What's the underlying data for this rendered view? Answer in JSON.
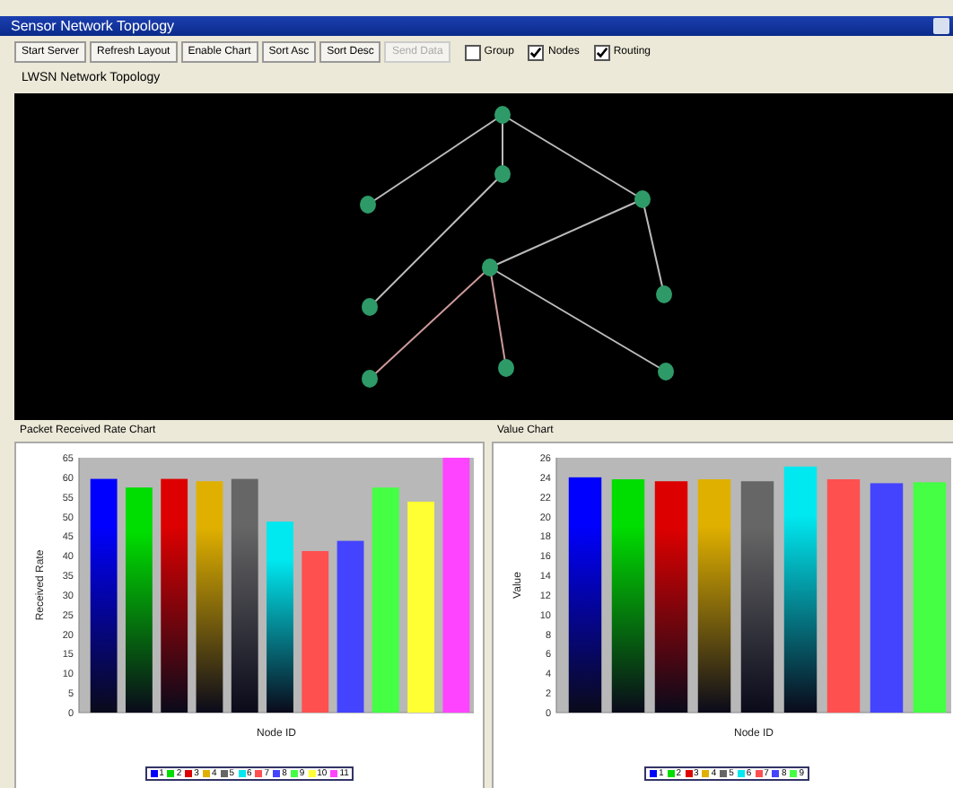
{
  "window": {
    "title": "Sensor Network Topology"
  },
  "toolbar": {
    "buttons": [
      {
        "label": "Start Server",
        "disabled": false
      },
      {
        "label": "Refresh Layout",
        "disabled": false
      },
      {
        "label": "Enable Chart",
        "disabled": false
      },
      {
        "label": "Sort Asc",
        "disabled": false
      },
      {
        "label": "Sort Desc",
        "disabled": false
      },
      {
        "label": "Send Data",
        "disabled": true
      }
    ],
    "checkboxes": [
      {
        "label": "Group",
        "checked": false
      },
      {
        "label": "Nodes",
        "checked": true
      },
      {
        "label": "Routing",
        "checked": true
      }
    ]
  },
  "topology": {
    "title": "LWSN Network Topology"
  },
  "charts": [
    {
      "title": "Packet Received Rate Chart",
      "chart_data": {
        "type": "bar",
        "xlabel": "Node ID",
        "ylabel": "Received Rate",
        "categories": [
          null,
          null,
          null,
          null,
          null,
          null,
          null,
          null,
          null,
          null,
          null
        ],
        "ylim": [
          0,
          65
        ],
        "yticks": [
          0,
          5,
          10,
          15,
          20,
          25,
          30,
          35,
          40,
          45,
          50,
          55,
          60,
          65
        ],
        "values": [
          59.6,
          57.4,
          59.6,
          59,
          59.6,
          48.7,
          41.2,
          43.8,
          57.4,
          53.8,
          65
        ]
      },
      "bar_styles": [
        {
          "color": "#0000ff",
          "gradient": true
        },
        {
          "color": "#00dd00",
          "gradient": true
        },
        {
          "color": "#dd0000",
          "gradient": true
        },
        {
          "color": "#e0b000",
          "gradient": true
        },
        {
          "color": "#666666",
          "gradient": true
        },
        {
          "color": "#00e8f0",
          "gradient": true
        },
        {
          "color": "#ff5050",
          "gradient": false
        },
        {
          "color": "#4444ff",
          "gradient": false
        },
        {
          "color": "#44ff44",
          "gradient": false
        },
        {
          "color": "#ffff33",
          "gradient": false
        },
        {
          "color": "#ff44ff",
          "gradient": false
        }
      ],
      "legend": [
        {
          "label": "1",
          "color": "#0000ff"
        },
        {
          "label": "2",
          "color": "#00dd00"
        },
        {
          "label": "3",
          "color": "#dd0000"
        },
        {
          "label": "4",
          "color": "#e0b000"
        },
        {
          "label": "5",
          "color": "#666666"
        },
        {
          "label": "6",
          "color": "#00e8f0"
        },
        {
          "label": "7",
          "color": "#ff5050"
        },
        {
          "label": "8",
          "color": "#4444ff"
        },
        {
          "label": "9",
          "color": "#44ff44"
        },
        {
          "label": "10",
          "color": "#ffff33"
        },
        {
          "label": "11",
          "color": "#ff44ff"
        }
      ]
    },
    {
      "title": "Value Chart",
      "chart_data": {
        "type": "bar",
        "xlabel": "Node ID",
        "ylabel": "Value",
        "categories": [
          null,
          null,
          null,
          null,
          null,
          null,
          null,
          null,
          null
        ],
        "ylim": [
          0,
          26
        ],
        "yticks": [
          0,
          2,
          4,
          6,
          8,
          10,
          12,
          14,
          16,
          18,
          20,
          22,
          24,
          26
        ],
        "values": [
          24,
          23.8,
          23.6,
          23.8,
          23.6,
          25.1,
          23.8,
          23.4,
          23.5
        ]
      },
      "bar_styles": [
        {
          "color": "#0000ff",
          "gradient": true
        },
        {
          "color": "#00dd00",
          "gradient": true
        },
        {
          "color": "#dd0000",
          "gradient": true
        },
        {
          "color": "#e0b000",
          "gradient": true
        },
        {
          "color": "#666666",
          "gradient": true
        },
        {
          "color": "#00e8f0",
          "gradient": true
        },
        {
          "color": "#ff5050",
          "gradient": false
        },
        {
          "color": "#4444ff",
          "gradient": false
        },
        {
          "color": "#44ff44",
          "gradient": false
        }
      ],
      "legend": [
        {
          "label": "1",
          "color": "#0000ff"
        },
        {
          "label": "2",
          "color": "#00dd00"
        },
        {
          "label": "3",
          "color": "#dd0000"
        },
        {
          "label": "4",
          "color": "#e0b000"
        },
        {
          "label": "5",
          "color": "#666666"
        },
        {
          "label": "6",
          "color": "#00e8f0"
        },
        {
          "label": "7",
          "color": "#ff5050"
        },
        {
          "label": "8",
          "color": "#4444ff"
        },
        {
          "label": "9",
          "color": "#44ff44"
        }
      ]
    }
  ]
}
